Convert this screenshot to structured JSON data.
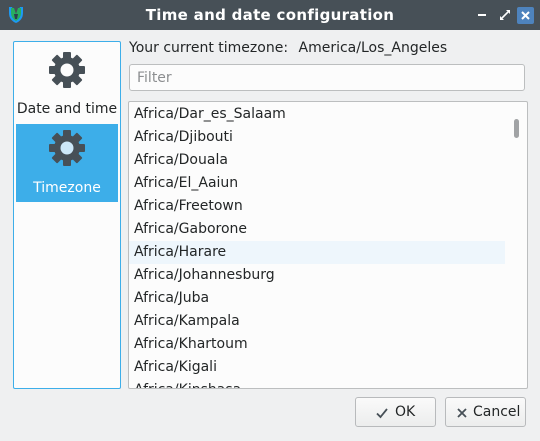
{
  "window": {
    "title": "Time and date configuration"
  },
  "sidebar": {
    "items": [
      {
        "label": "Date and time",
        "icon": "gear-icon",
        "selected": false
      },
      {
        "label": "Timezone",
        "icon": "gear-icon",
        "selected": true
      }
    ]
  },
  "main": {
    "current_tz_label": "Your current timezone:",
    "current_tz_value": "America/Los_Angeles",
    "filter_placeholder": "Filter",
    "timezones": [
      "Africa/Dar_es_Salaam",
      "Africa/Djibouti",
      "Africa/Douala",
      "Africa/El_Aaiun",
      "Africa/Freetown",
      "Africa/Gaborone",
      "Africa/Harare",
      "Africa/Johannesburg",
      "Africa/Juba",
      "Africa/Kampala",
      "Africa/Khartoum",
      "Africa/Kigali",
      "Africa/Kinshasa"
    ],
    "hovered_item": "Africa/Harare"
  },
  "buttons": {
    "ok_label": "OK",
    "cancel_label": "Cancel"
  },
  "colors": {
    "titlebar": "#475057",
    "accent": "#3daee9",
    "close_button": "#4e83bd"
  }
}
